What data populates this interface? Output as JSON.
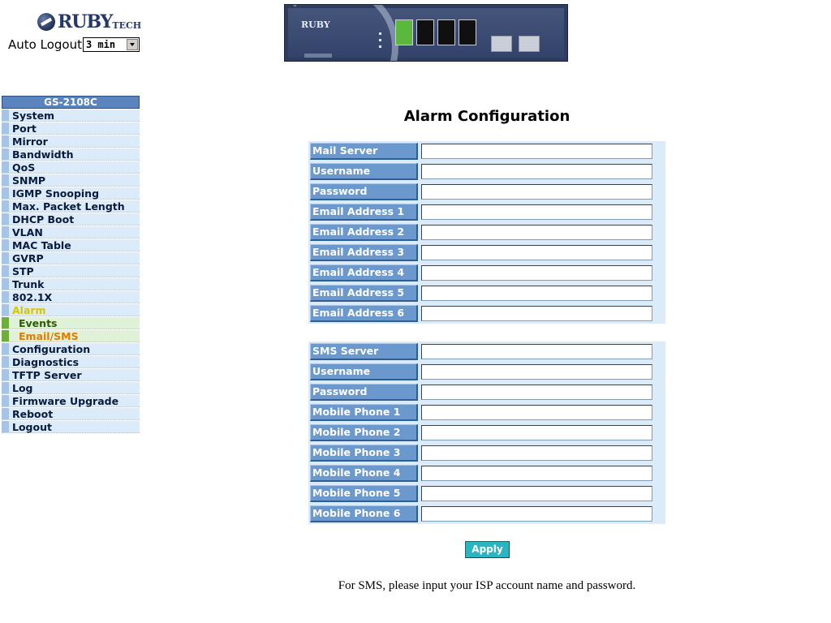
{
  "header": {
    "logo_text": "RUBY",
    "logo_suffix": "TECH",
    "auto_logout_label": "Auto Logout",
    "auto_logout_value": "3 min"
  },
  "sidebar": {
    "model": "GS-2108C",
    "items": [
      {
        "label": "System"
      },
      {
        "label": "Port"
      },
      {
        "label": "Mirror"
      },
      {
        "label": "Bandwidth"
      },
      {
        "label": "QoS"
      },
      {
        "label": "SNMP"
      },
      {
        "label": "IGMP Snooping"
      },
      {
        "label": "Max. Packet Length"
      },
      {
        "label": "DHCP Boot"
      },
      {
        "label": "VLAN"
      },
      {
        "label": "MAC Table"
      },
      {
        "label": "GVRP"
      },
      {
        "label": "STP"
      },
      {
        "label": "Trunk"
      },
      {
        "label": "802.1X"
      },
      {
        "label": "Alarm"
      },
      {
        "label": "Events"
      },
      {
        "label": "Email/SMS"
      },
      {
        "label": "Configuration"
      },
      {
        "label": "Diagnostics"
      },
      {
        "label": "TFTP Server"
      },
      {
        "label": "Log"
      },
      {
        "label": "Firmware Upgrade"
      },
      {
        "label": "Reboot"
      },
      {
        "label": "Logout"
      }
    ]
  },
  "main": {
    "title": "Alarm Configuration",
    "email_fields": [
      {
        "label": "Mail Server",
        "value": ""
      },
      {
        "label": "Username",
        "value": ""
      },
      {
        "label": "Password",
        "value": ""
      },
      {
        "label": "Email Address 1",
        "value": ""
      },
      {
        "label": "Email Address 2",
        "value": ""
      },
      {
        "label": "Email Address 3",
        "value": ""
      },
      {
        "label": "Email Address 4",
        "value": ""
      },
      {
        "label": "Email Address 5",
        "value": ""
      },
      {
        "label": "Email Address 6",
        "value": ""
      }
    ],
    "sms_fields": [
      {
        "label": "SMS Server",
        "value": ""
      },
      {
        "label": "Username",
        "value": ""
      },
      {
        "label": "Password",
        "value": ""
      },
      {
        "label": "Mobile Phone 1",
        "value": ""
      },
      {
        "label": "Mobile Phone 2",
        "value": ""
      },
      {
        "label": "Mobile Phone 3",
        "value": ""
      },
      {
        "label": "Mobile Phone 4",
        "value": ""
      },
      {
        "label": "Mobile Phone 5",
        "value": ""
      },
      {
        "label": "Mobile Phone 6",
        "value": ""
      }
    ],
    "apply_label": "Apply",
    "note": "For SMS, please input your ISP account name and password."
  },
  "colors": {
    "label_bg": "#6b98cd",
    "table_bg": "#dcebfa",
    "apply_bg": "#2ab5c2",
    "menu_active_parent": "#d8c400",
    "menu_current": "#e07b00"
  }
}
